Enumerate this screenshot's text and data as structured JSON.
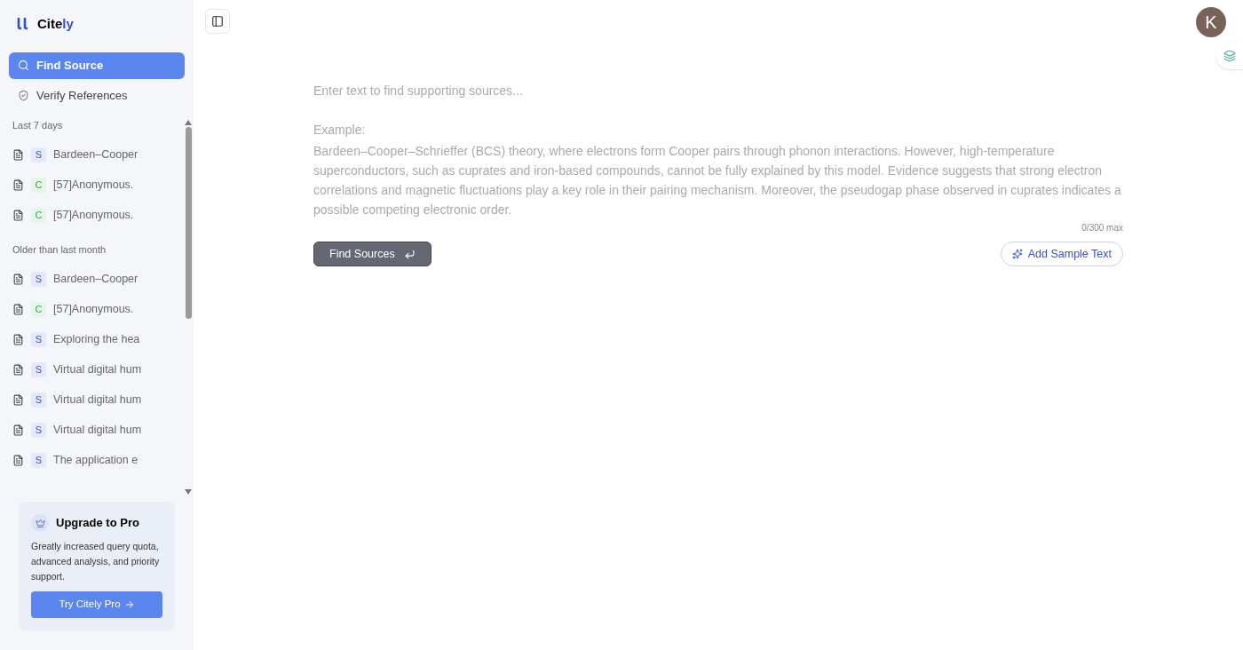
{
  "brand": {
    "name": "Cite",
    "accent": "ly"
  },
  "nav": [
    {
      "label": "Find Source",
      "selected": true
    },
    {
      "label": "Verify References",
      "selected": false
    }
  ],
  "history": [
    {
      "heading": "Last 7 days",
      "items": [
        {
          "badge": "S",
          "color": "#e3e8fb",
          "title": "Bardeen–Cooper"
        },
        {
          "badge": "C",
          "color": "#e4f6e6",
          "title": "[57]Anonymous."
        },
        {
          "badge": "C",
          "color": "#e4f6e6",
          "title": "[57]Anonymous."
        }
      ]
    },
    {
      "heading": "Older than last month",
      "items": [
        {
          "badge": "S",
          "color": "#e3e8fb",
          "title": "Bardeen–Cooper"
        },
        {
          "badge": "C",
          "color": "#e4f6e6",
          "title": "[57]Anonymous."
        },
        {
          "badge": "S",
          "color": "#e3e8fb",
          "title": "Exploring the hea"
        },
        {
          "badge": "S",
          "color": "#e3e8fb",
          "title": "Virtual digital hum"
        },
        {
          "badge": "S",
          "color": "#e3e8fb",
          "title": "Virtual digital hum"
        },
        {
          "badge": "S",
          "color": "#e3e8fb",
          "title": "Virtual digital hum"
        },
        {
          "badge": "S",
          "color": "#e3e8fb",
          "title": "The application e"
        }
      ]
    }
  ],
  "upgrade": {
    "title": "Upgrade to Pro",
    "text": "Greatly increased query quota, advanced analysis, and priority support.",
    "button": "Try Citely Pro"
  },
  "avatar": "K",
  "editor": {
    "placeholder": "Enter text to find supporting sources...",
    "example_label": "Example:",
    "example_text": "Bardeen–Cooper–Schrieffer (BCS) theory, where electrons form Cooper pairs through phonon interactions. However, high-temperature superconductors, such as cuprates and iron-based compounds, cannot be fully explained by this model. Evidence suggests that strong electron correlations and magnetic fluctuations play a key role in their pairing mechanism. Moreover, the pseudogap phase observed in cuprates indicates a possible competing electronic order.",
    "counter": "0/300 max",
    "submit": "Find Sources",
    "sample": "Add Sample Text"
  }
}
